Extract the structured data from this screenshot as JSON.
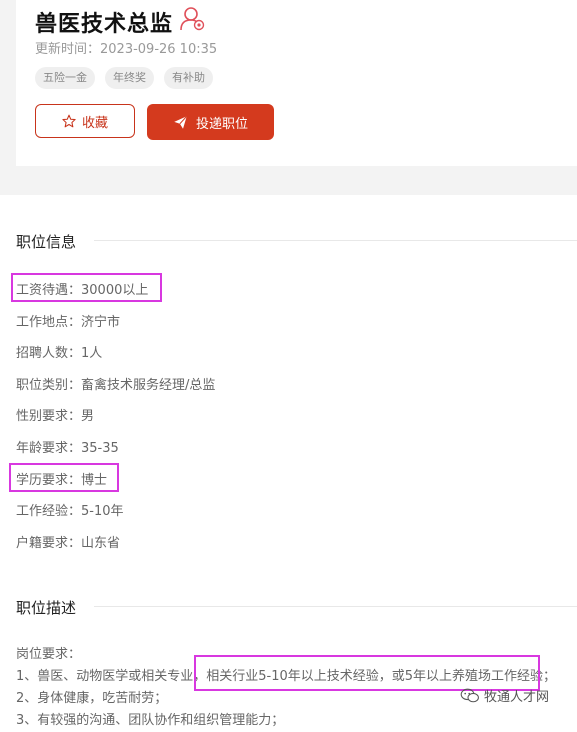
{
  "job": {
    "title": "兽医技术总监",
    "update_time": "更新时间：2023-09-26 10:35",
    "tags": [
      "五险一金",
      "年终奖",
      "有补助"
    ]
  },
  "actions": {
    "favorite_label": "收藏",
    "apply_label": "投递职位"
  },
  "sections": {
    "info_title": "职位信息",
    "desc_title": "职位描述"
  },
  "info": [
    "工资待遇：30000以上",
    "工作地点：济宁市",
    "招聘人数：1人",
    "职位类别：畜禽技术服务经理/总监",
    "性别要求：男",
    "年龄要求：35-35",
    "学历要求：博士",
    "工作经验：5-10年",
    "户籍要求：山东省"
  ],
  "description": {
    "heading": "岗位要求：",
    "line1_a": "1、兽医、动物医学或相关专业，",
    "line1_b": "相关行业5-10年以上技术经验，或5年以上养殖场工作经验；",
    "line2": "2、身体健康，吃苦耐劳；",
    "line3": "3、有较强的沟通、团队协作和组织管理能力；"
  },
  "watermark": "牧通人才网",
  "colors": {
    "accent": "#d43a1e",
    "highlight": "#d838e0",
    "icon": "#e0505a"
  }
}
